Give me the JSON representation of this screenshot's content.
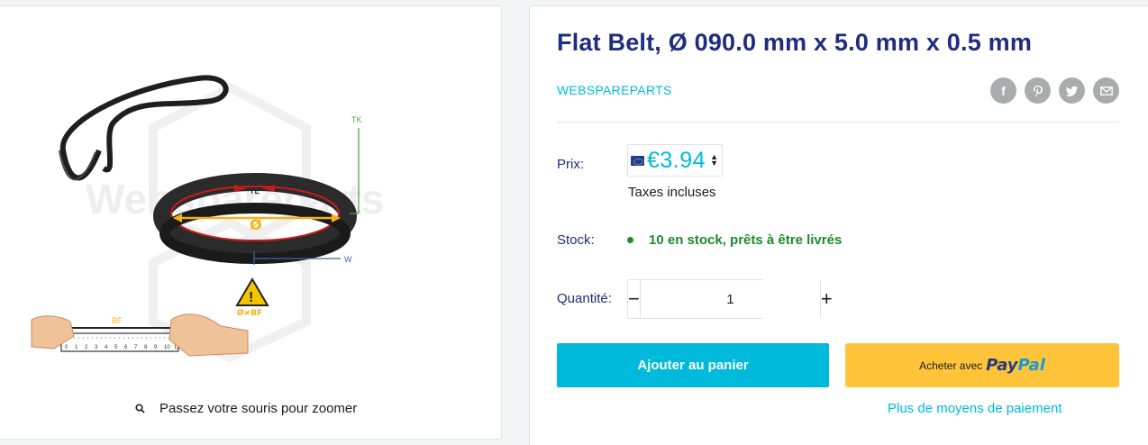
{
  "gallery": {
    "zoom_hint": "Passez votre souris pour zoomer",
    "image_labels": {
      "tk": "TK",
      "tl": "TL",
      "diameter": "Ø",
      "w": "W",
      "warning": "Ø≠BF",
      "bf": "BF",
      "ruler_numbers": [
        "0",
        "1",
        "2",
        "3",
        "4",
        "5",
        "6",
        "7",
        "8",
        "9",
        "10",
        "11"
      ],
      "watermark": "Webspareparts"
    }
  },
  "product": {
    "title": "Flat Belt, Ø 090.0 mm x 5.0 mm x 0.5 mm",
    "vendor": "WEBSPAREPARTS",
    "share_icons": [
      "facebook-icon",
      "pinterest-icon",
      "twitter-icon",
      "email-icon"
    ]
  },
  "price": {
    "label": "Prix:",
    "value": "€3.94",
    "tax_note": "Taxes incluses"
  },
  "stock": {
    "label": "Stock:",
    "status": "10 en stock, prêts à être livrés"
  },
  "quantity": {
    "label": "Quantité:",
    "value": "1",
    "minus": "−",
    "plus": "+"
  },
  "actions": {
    "add_to_cart": "Ajouter au panier",
    "paypal_prefix": "Acheter avec",
    "paypal_brand_1": "Pay",
    "paypal_brand_2": "Pal",
    "more_payment": "Plus de moyens de paiement"
  },
  "colors": {
    "accent": "#00badb",
    "heading": "#1e2d7d",
    "stock_green": "#1c8b2c",
    "paypal_yellow": "#ffc43a"
  }
}
